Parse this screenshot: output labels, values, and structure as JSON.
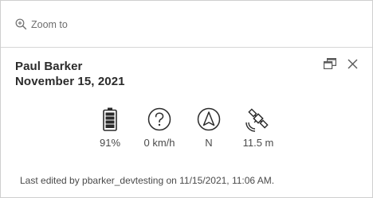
{
  "actions": {
    "zoom_label": "Zoom to"
  },
  "header": {
    "title": "Paul Barker",
    "subtitle": "November 15, 2021"
  },
  "icons": {
    "dock": "dock-icon",
    "close": "close-icon"
  },
  "metrics": [
    {
      "icon": "battery-icon",
      "value": "91%"
    },
    {
      "icon": "question-circle-icon",
      "value": "0 km/h"
    },
    {
      "icon": "compass-arrow-icon",
      "value": "N"
    },
    {
      "icon": "satellite-icon",
      "value": "11.5 m"
    }
  ],
  "footer": {
    "text": "Last edited by pbarker_devtesting on 11/15/2021, 11:06 AM."
  },
  "colors": {
    "text": "#323232",
    "muted": "#6e6e6e",
    "border": "#cfcfcf"
  }
}
